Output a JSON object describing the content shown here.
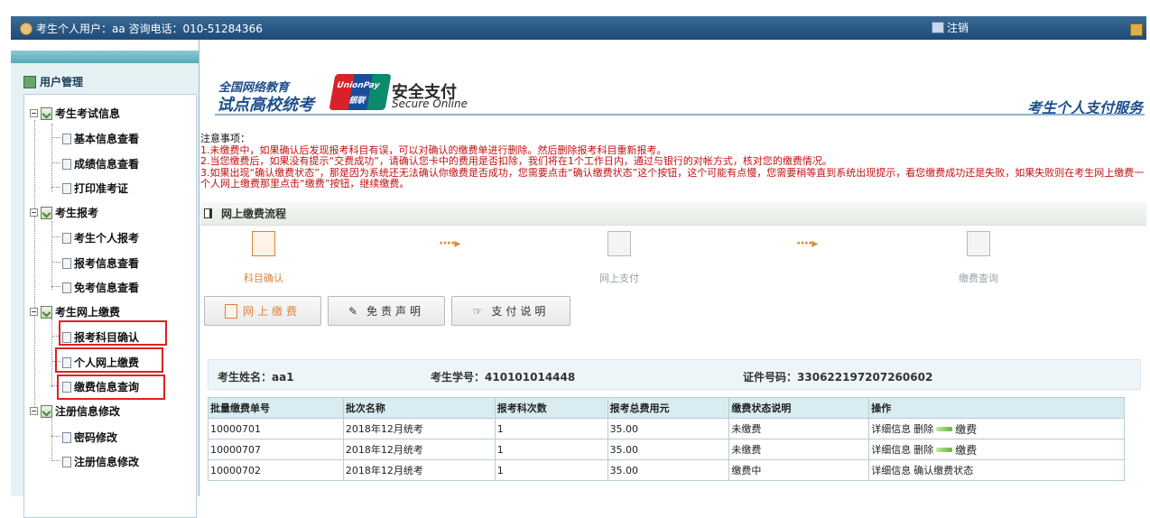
{
  "header": {
    "user_info": "考生个人用户：aa 咨询电话：010-51284366",
    "logout_label": "注销"
  },
  "sidebar": {
    "title": "用户管理",
    "groups": [
      {
        "label": "考生考试信息",
        "items": [
          "基本信息查看",
          "成绩信息查看",
          "打印准考证"
        ]
      },
      {
        "label": "考生报考",
        "items": [
          "考生个人报考",
          "报考信息查看",
          "免考信息查看"
        ]
      },
      {
        "label": "考生网上缴费",
        "items": [
          "报考科目确认",
          "个人网上缴费",
          "缴费信息查询"
        ]
      },
      {
        "label": "注册信息修改",
        "items": [
          "密码修改",
          "注册信息修改"
        ]
      }
    ]
  },
  "brand": {
    "line1": "全国网络教育",
    "line2": "试点高校统考",
    "unionpay_en": "UnionPay",
    "unionpay_cn": "银联",
    "secure_cn": "安全支付",
    "secure_en": "Secure Online",
    "slogan": "考生个人支付服务"
  },
  "notes": {
    "head": "注意事项：",
    "items": [
      "1.未缴费中，如果确认后发现报考科目有误，可以对确认的缴费单进行删除。然后删除报考科目重新报考。",
      "2.当您缴费后，如果没有提示“交费成功”，请确认您卡中的费用是否扣除，我们将在1个工作日内，通过与银行的对帐方式，核对您的缴费情况。",
      "3.如果出现“确认缴费状态”，那是因为系统还无法确认你缴费是否成功，您需要点击“确认缴费状态”这个按钮，这个可能有点慢，您需要稍等直到系统出现提示，看您缴费成功还是失败，如果失败则在考生网上缴费一个人网上缴费那里点击“缴费”按钮，继续缴费。"
    ]
  },
  "flow": {
    "title": "网上缴费流程",
    "steps": [
      "科目确认",
      "网上支付",
      "缴费查询"
    ]
  },
  "buttons": {
    "pay": "网上缴费",
    "disclaimer": "免责声明",
    "instructions": "支付说明"
  },
  "info": {
    "name_label": "考生姓名：",
    "name": "aa1",
    "id_label": "考生学号：",
    "id": "410101014448",
    "cert_label": "证件号码：",
    "cert": "330622197207260602"
  },
  "table": {
    "headers": [
      "批量缴费单号",
      "批次名称",
      "报考科次数",
      "报考总费用元",
      "缴费状态说明",
      "操作"
    ],
    "rows": [
      {
        "no": "10000701",
        "batch": "2018年12月统考",
        "count": "1",
        "fee": "35.00",
        "status": "未缴费",
        "actions": [
          "详细信息",
          "删除",
          "缴费"
        ]
      },
      {
        "no": "10000707",
        "batch": "2018年12月统考",
        "count": "1",
        "fee": "35.00",
        "status": "未缴费",
        "actions": [
          "详细信息",
          "删除",
          "缴费"
        ]
      },
      {
        "no": "10000702",
        "batch": "2018年12月统考",
        "count": "1",
        "fee": "35.00",
        "status": "缴费中",
        "actions": [
          "详细信息",
          "确认缴费状态"
        ]
      }
    ]
  }
}
